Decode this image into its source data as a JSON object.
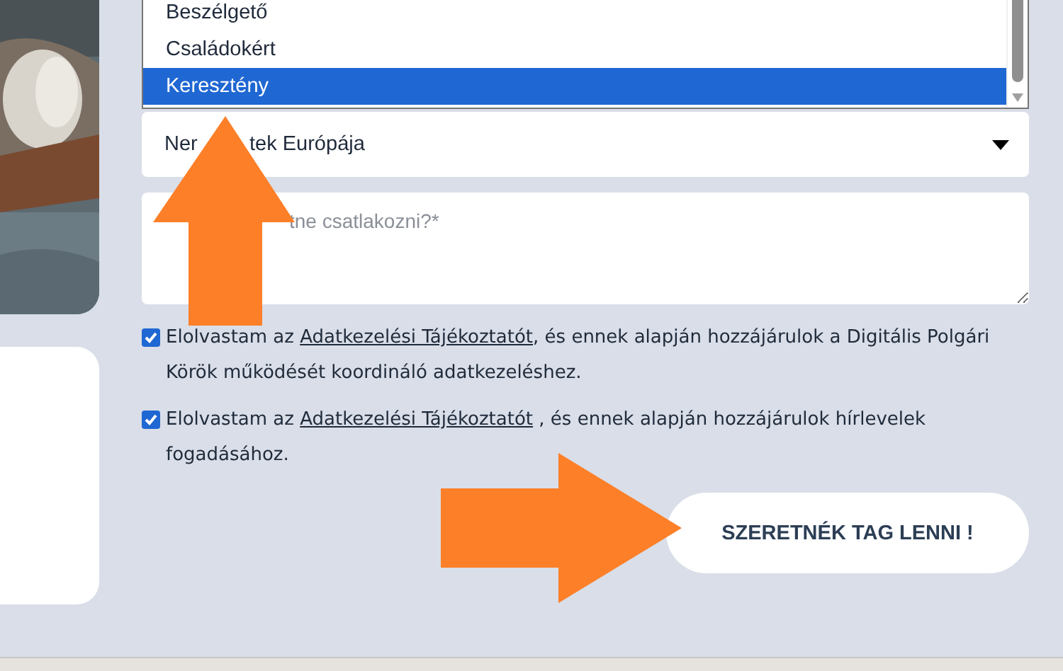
{
  "listbox": {
    "options": [
      {
        "label": "Beszélgető",
        "selected": false
      },
      {
        "label": "Családokért",
        "selected": false
      },
      {
        "label": "Keresztény",
        "selected": true
      }
    ]
  },
  "select": {
    "value_parts": [
      "Ner",
      "tek Európája"
    ]
  },
  "message": {
    "placeholder": "tne csatlakozni?*"
  },
  "consents": [
    {
      "checked": true,
      "before": "Elolvastam az ",
      "link": "Adatkezelési Tájékoztatót",
      "after": ", és ennek alapján hozzájárulok a Digitális Polgári Körök működését koordináló adatkezeléshez."
    },
    {
      "checked": true,
      "before": "Elolvastam az ",
      "link": "Adatkezelési Tájékoztatót",
      "after": " , és ennek alapján hozzájárulok hírlevelek fogadásához."
    }
  ],
  "submit": {
    "label": "SZERETNÉK TAG LENNI !"
  },
  "annotations": [
    {
      "kind": "arrow-up"
    },
    {
      "kind": "arrow-right"
    }
  ]
}
